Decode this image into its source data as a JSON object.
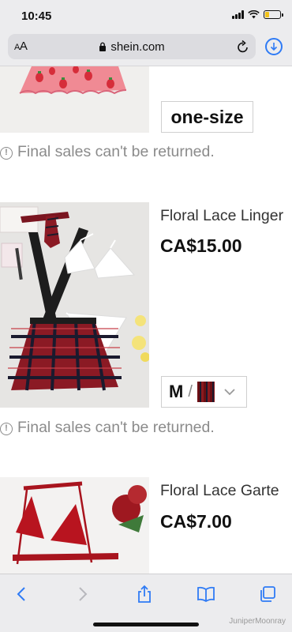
{
  "status_bar": {
    "time": "10:45",
    "battery_level": 0.25,
    "battery_color": "#f1c21b"
  },
  "address_bar": {
    "text_size_label": "AA",
    "url": "shein.com"
  },
  "products": [
    {
      "size_label": "one-size",
      "notice": "Final sales can't be returned.",
      "image": "strawberry-print-skirt"
    },
    {
      "name": "Floral Lace Linger",
      "price": "CA$15.00",
      "selected_size": "M",
      "separator": "/",
      "image": "plaid-schoolgirl-lingerie-set",
      "notice": "Final sales can't be returned."
    },
    {
      "name": "Floral Lace Garte",
      "price": "CA$7.00",
      "image": "red-lace-garter-set"
    }
  ],
  "toolbar": {
    "back": "back-icon",
    "forward": "forward-icon",
    "share": "share-icon",
    "bookmarks": "book-icon",
    "tabs": "tabs-icon"
  },
  "watermark": "JuniperMoonray",
  "colors": {
    "accent": "#2f7bf5",
    "notice_gray": "#8b8b8b"
  }
}
